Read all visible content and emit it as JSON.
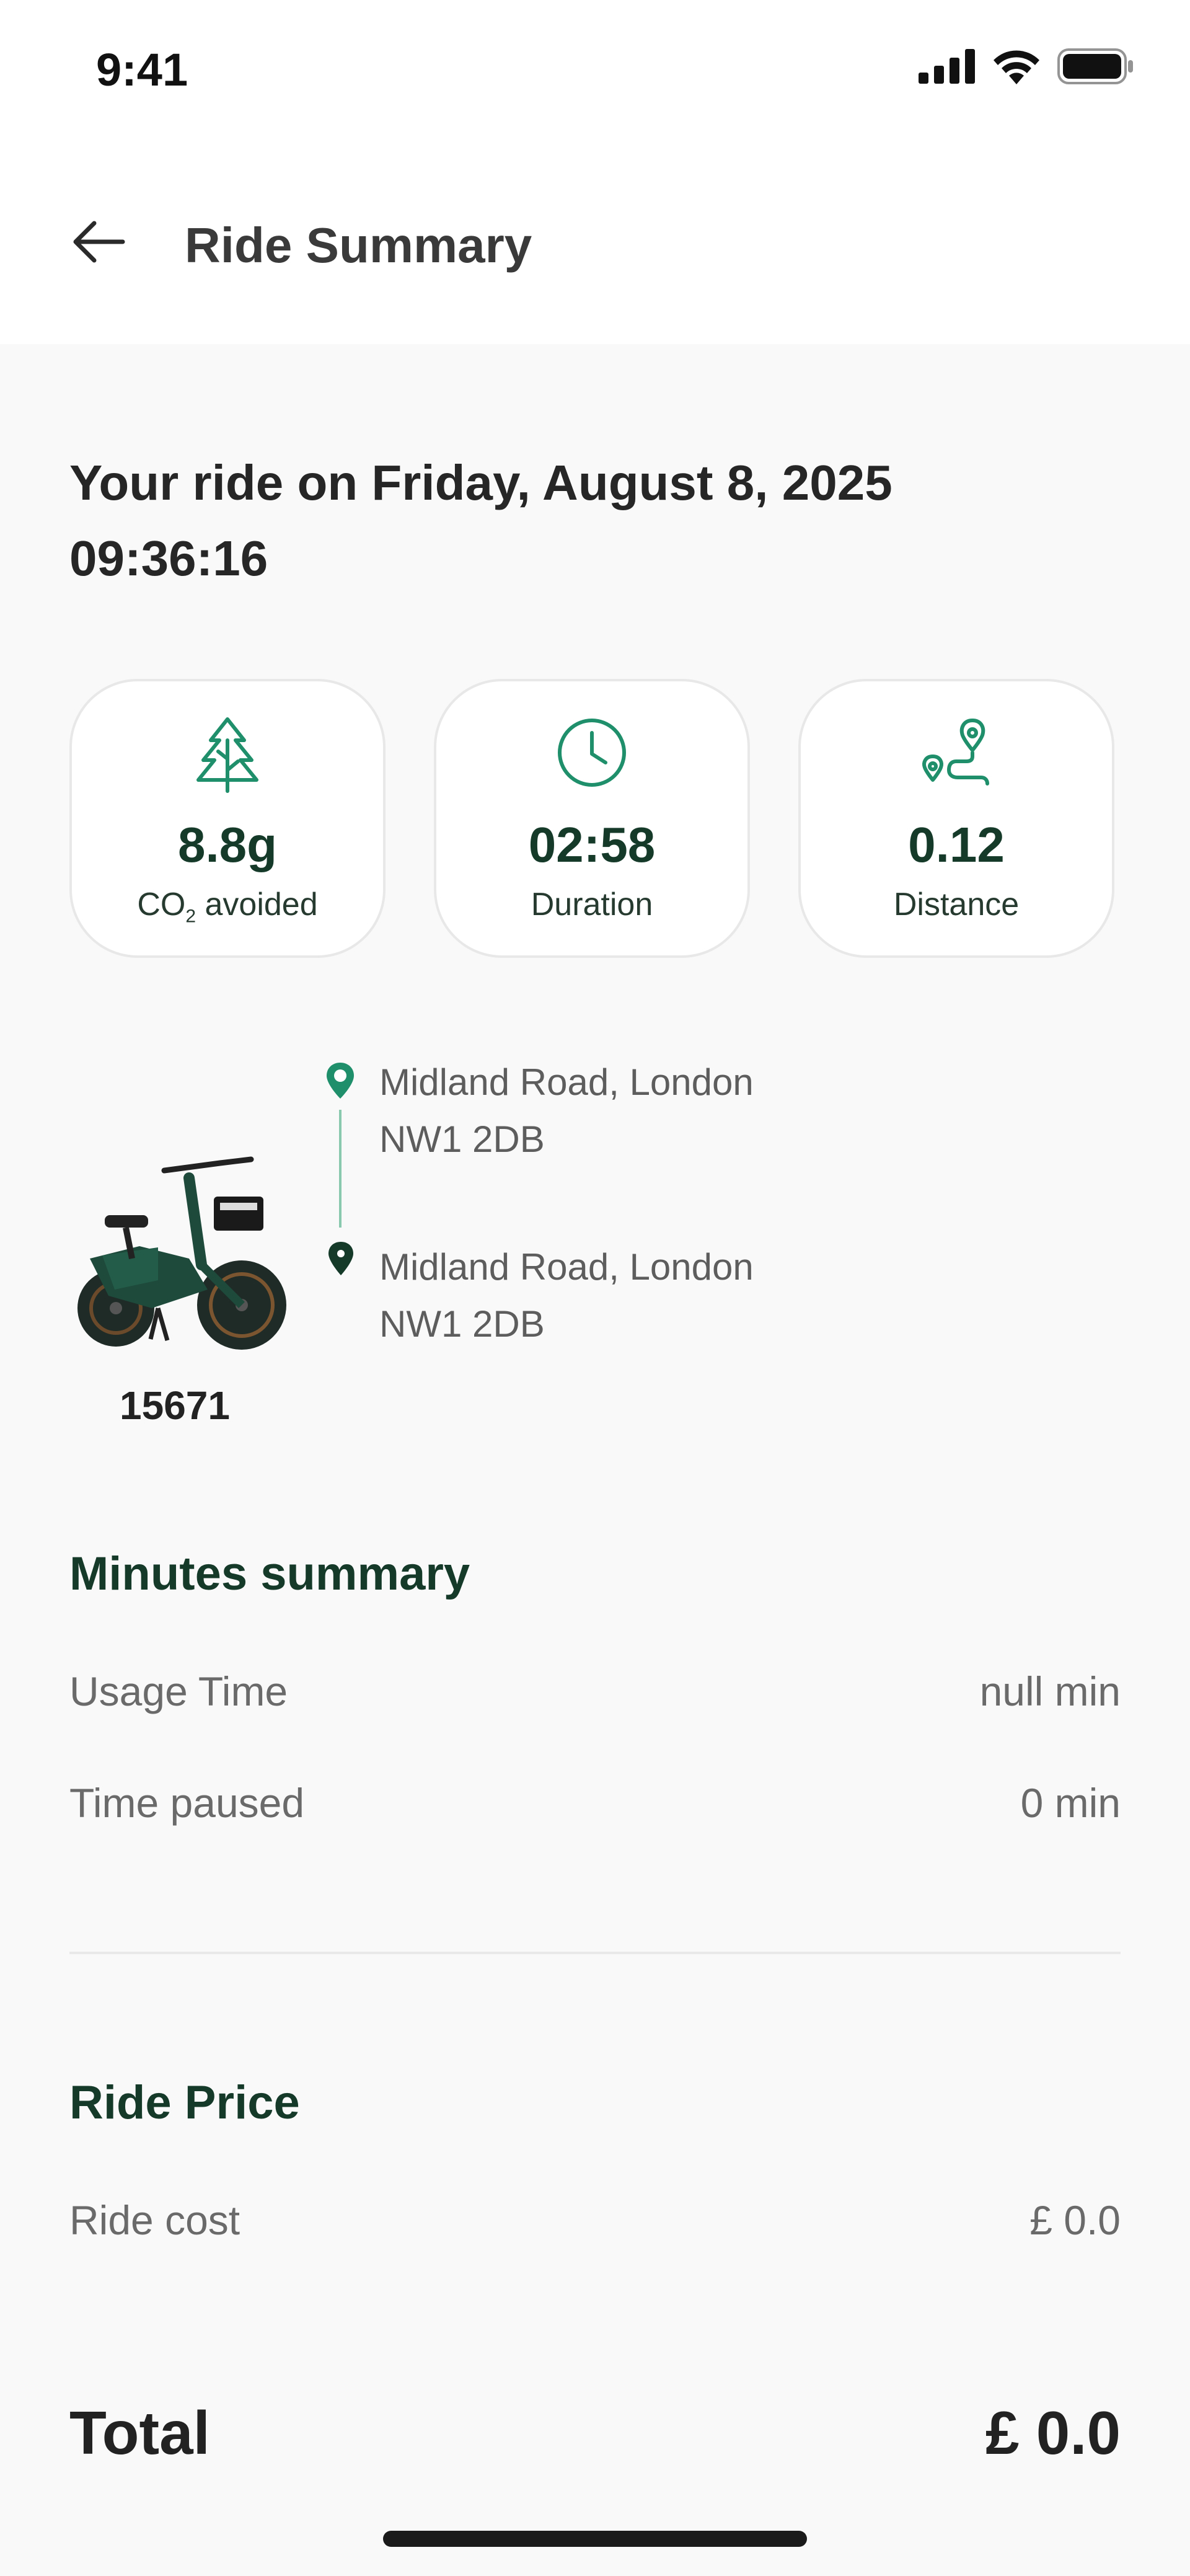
{
  "status_bar": {
    "time": "9:41"
  },
  "header": {
    "title": "Ride Summary"
  },
  "ride": {
    "heading_line1": "Your ride on Friday, August 8, 2025",
    "heading_line2": "09:36:16"
  },
  "stats": [
    {
      "icon": "tree-icon",
      "value": "8.8g",
      "label_main": "CO",
      "label_sub": "2",
      "label_rest": " avoided"
    },
    {
      "icon": "clock-icon",
      "value": "02:58",
      "label": "Duration"
    },
    {
      "icon": "route-icon",
      "value": "0.12",
      "label": "Distance"
    }
  ],
  "bike": {
    "id": "15671"
  },
  "route": {
    "start": {
      "line1": "Midland Road, London",
      "line2": "NW1 2DB"
    },
    "end": {
      "line1": "Midland Road, London",
      "line2": "NW1 2DB"
    }
  },
  "minutes_summary": {
    "title": "Minutes summary",
    "rows": [
      {
        "label": "Usage Time",
        "value": "null min"
      },
      {
        "label": "Time paused",
        "value": "0 min"
      }
    ]
  },
  "ride_price": {
    "title": "Ride Price",
    "rows": [
      {
        "label": "Ride cost",
        "value": "£ 0.0"
      }
    ]
  },
  "total": {
    "label": "Total",
    "value": "£ 0.0"
  },
  "colors": {
    "brand_green": "#1e8f6a",
    "dark_green": "#153a2a"
  }
}
